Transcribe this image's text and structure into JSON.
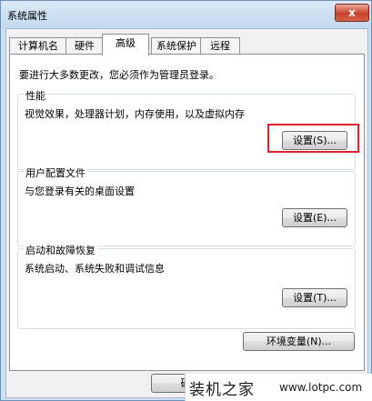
{
  "window": {
    "title": "系统属性",
    "close_label": "x"
  },
  "tabs": [
    {
      "label": "计算机名",
      "active": false
    },
    {
      "label": "硬件",
      "active": false
    },
    {
      "label": "高级",
      "active": true
    },
    {
      "label": "系统保护",
      "active": false
    },
    {
      "label": "远程",
      "active": false
    }
  ],
  "intro_text": "要进行大多数更改，您必须作为管理员登录。",
  "performance": {
    "title": "性能",
    "description": "视觉效果，处理器计划，内存使用，以及虚拟内存",
    "button_label": "设置(S)..."
  },
  "user_profiles": {
    "title": "用户配置文件",
    "description": "与您登录有关的桌面设置",
    "button_label": "设置(E)..."
  },
  "startup_recovery": {
    "title": "启动和故障恢复",
    "description": "系统启动、系统失败和调试信息",
    "button_label": "设置(T)..."
  },
  "env_button_label": "环境变量(N)...",
  "footer": {
    "ok_label": "确"
  },
  "watermark": {
    "brand": "装机之家",
    "url": "www.lotpc.com"
  },
  "colors": {
    "highlight": "#d9232e",
    "title_bar": "#c4d8ee",
    "close_button": "#c7412a"
  }
}
